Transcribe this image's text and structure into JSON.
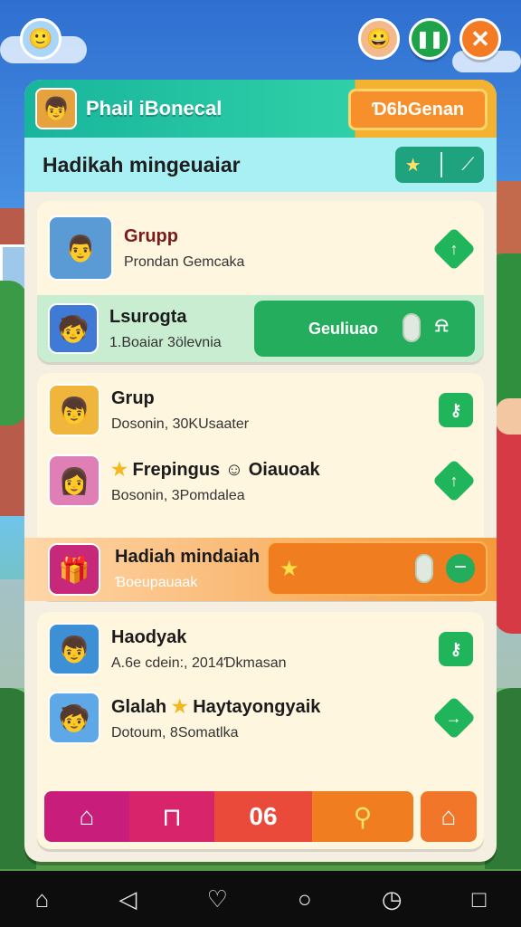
{
  "header": {
    "profile_name": "Phail iBonecal",
    "header_button": "Ɗ6bGenan"
  },
  "title_bar": {
    "title": "Hadikah mingeuaiar"
  },
  "section1": {
    "row1": {
      "name": "Grupp",
      "sub": "Prondan Gemcaka"
    },
    "row2": {
      "name": "Lsurogta",
      "sub": "1.Boaiar 3ölevnia",
      "button": "Geuliuao"
    }
  },
  "section2": {
    "row1": {
      "name": "Grup",
      "sub": "Dosonin, 30KUsaater"
    },
    "row2": {
      "name": "Frepingus",
      "name2": "Oiauoak",
      "sub": "Bosonin, 3Pomdalea"
    },
    "gift": {
      "title": "Hadiah mindaiah",
      "sub": "Ɓoeupauaak"
    }
  },
  "section3": {
    "row1": {
      "name": "Haodyak",
      "sub": "A.6e cdein:, 2014Ɗkmasan"
    },
    "row2": {
      "name": "Glalah",
      "name2": "Haytayongyaik",
      "sub": "Dotoum, 8Somatlka"
    }
  },
  "bottom_nav": {
    "count": "06"
  },
  "icons": {
    "home": "home-icon",
    "back": "back-icon",
    "heart": "heart-icon",
    "circle": "home-circle-icon",
    "clock": "clock-icon",
    "square": "recents-icon"
  },
  "colors": {
    "accent_green": "#20b55a",
    "accent_orange": "#f07d1f",
    "header_teal": "#18b59c",
    "title_cyan": "#a8f0f3"
  }
}
